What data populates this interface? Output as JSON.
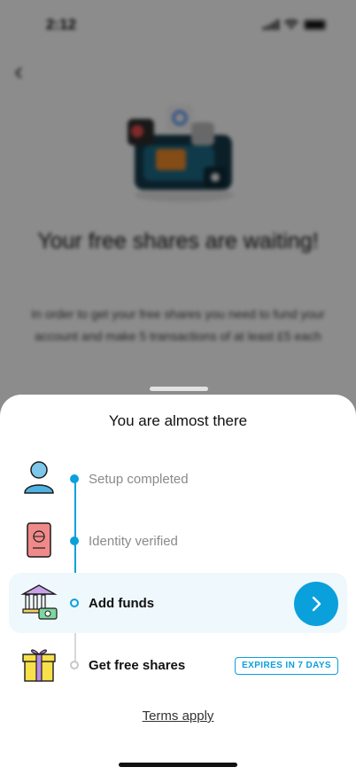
{
  "status_bar": {
    "time": "2:12"
  },
  "background": {
    "title": "Your free shares are waiting!",
    "description": "In order to get your free shares you need to fund your account and make 5 transactions of at least £5 each"
  },
  "sheet": {
    "title": "You are almost there",
    "steps": [
      {
        "label": "Setup completed",
        "state": "done",
        "icon": "person-icon"
      },
      {
        "label": "Identity verified",
        "state": "done",
        "icon": "passport-icon"
      },
      {
        "label": "Add funds",
        "state": "current",
        "icon": "bank-money-icon"
      },
      {
        "label": "Get free shares",
        "state": "todo",
        "icon": "gift-icon",
        "badge": "EXPIRES IN 7 DAYS"
      }
    ],
    "terms_link": "Terms apply"
  },
  "colors": {
    "accent": "#0aa0dc",
    "current_row_bg": "#eff8fc"
  }
}
